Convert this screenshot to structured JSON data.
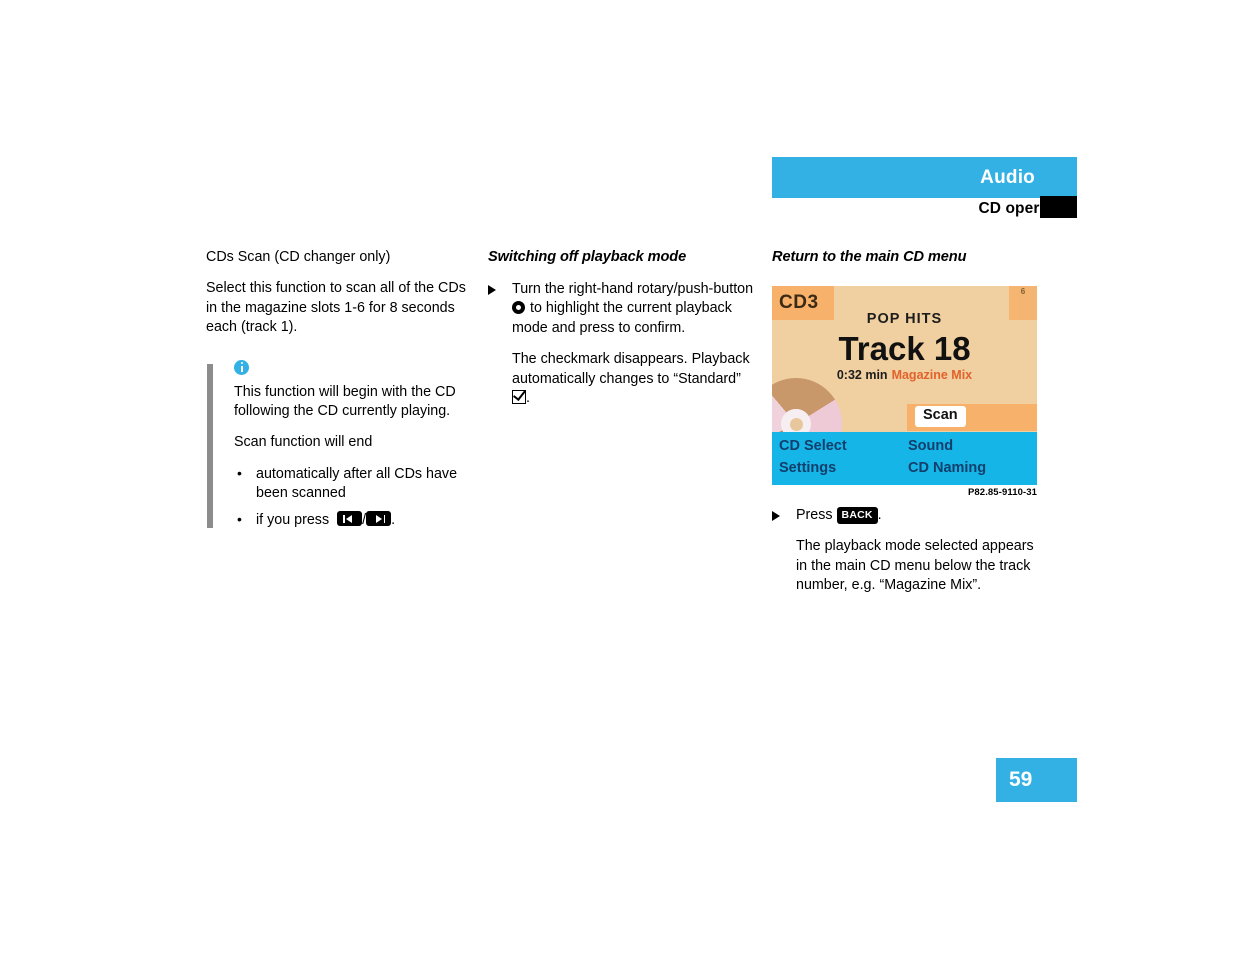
{
  "header": {
    "title": "Audio",
    "subtitle": "CD operation",
    "accent_color": "#33b1e4",
    "tab_marker_color": "#000000"
  },
  "left_column": {
    "section_title": "CDs Scan (CD changer only)",
    "intro": "Select this function to scan all of the CDs in the magazine slots 1-6 for 8 seconds each (track 1).",
    "note": {
      "icon": "info-icon",
      "paragraph": "This function will begin with the CD following the CD currently playing.",
      "list_intro": "Scan function will end",
      "bullets": [
        "automatically after all CDs have been scanned",
        "if you press"
      ],
      "bullet_2_suffix": ".",
      "key_prev": "skip-previous",
      "key_separator": "/",
      "key_next": "skip-next"
    }
  },
  "middle_column": {
    "heading": "Switching off playback mode",
    "step_1_part_a": "Turn the right-hand rotary/push-button",
    "step_1_part_b": "to highlight the current playback mode and press to confirm.",
    "result_text": "The checkmark disappears. Playback automatically changes to “Standard”",
    "result_suffix": ".",
    "rotary_icon": "rotary-push-button-icon",
    "check_icon": "checkmark-box-icon"
  },
  "right_column": {
    "heading": "Return to the main CD menu",
    "figure": {
      "caption": "P82.85-9110-31",
      "display": {
        "cd_label": "CD3",
        "slot_indicator": "6",
        "album": "POP HITS",
        "track": "Track 18",
        "elapsed_time": "0:32 min",
        "playback_mode": "Magazine Mix",
        "highlighted_item": "Scan",
        "menu_items": [
          "CD Select",
          "Sound",
          "Settings",
          "CD Naming"
        ],
        "background_color": "#f0cfa0",
        "accent_color": "#f7b16a",
        "menu_bar_color": "#15b5e8",
        "mode_text_color": "#e2622c"
      }
    },
    "step_press_label": "Press",
    "step_press_key": "BACK",
    "step_press_suffix": ".",
    "result_text": "The playback mode selected appears in the main CD menu below the track number, e.g. “Magazine Mix”."
  },
  "footer": {
    "page_number": "59"
  }
}
